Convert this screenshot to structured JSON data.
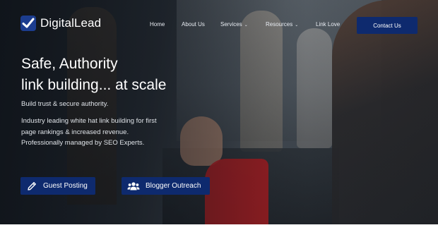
{
  "brand": {
    "name": "DigitalLead",
    "accent": "#0e2a6e"
  },
  "nav": {
    "items": [
      {
        "label": "Home",
        "has_dropdown": false
      },
      {
        "label": "About Us",
        "has_dropdown": false
      },
      {
        "label": "Services",
        "has_dropdown": true
      },
      {
        "label": "Resources",
        "has_dropdown": true
      },
      {
        "label": "Link Love",
        "has_dropdown": false
      }
    ],
    "dropdown_glyph": "⌄",
    "contact_label": "Contact Us"
  },
  "hero": {
    "headline_line1": "Safe, Authority",
    "headline_line2": "link building... at scale",
    "tagline": "Build trust & secure authority.",
    "description": "Industry leading white hat link building for first page rankings & increased revenue. Professionally managed by SEO Experts.",
    "cta_guest": {
      "label": "Guest Posting",
      "icon": "pencil-icon"
    },
    "cta_blogger": {
      "label": "Blogger Outreach",
      "icon": "users-icon"
    }
  }
}
